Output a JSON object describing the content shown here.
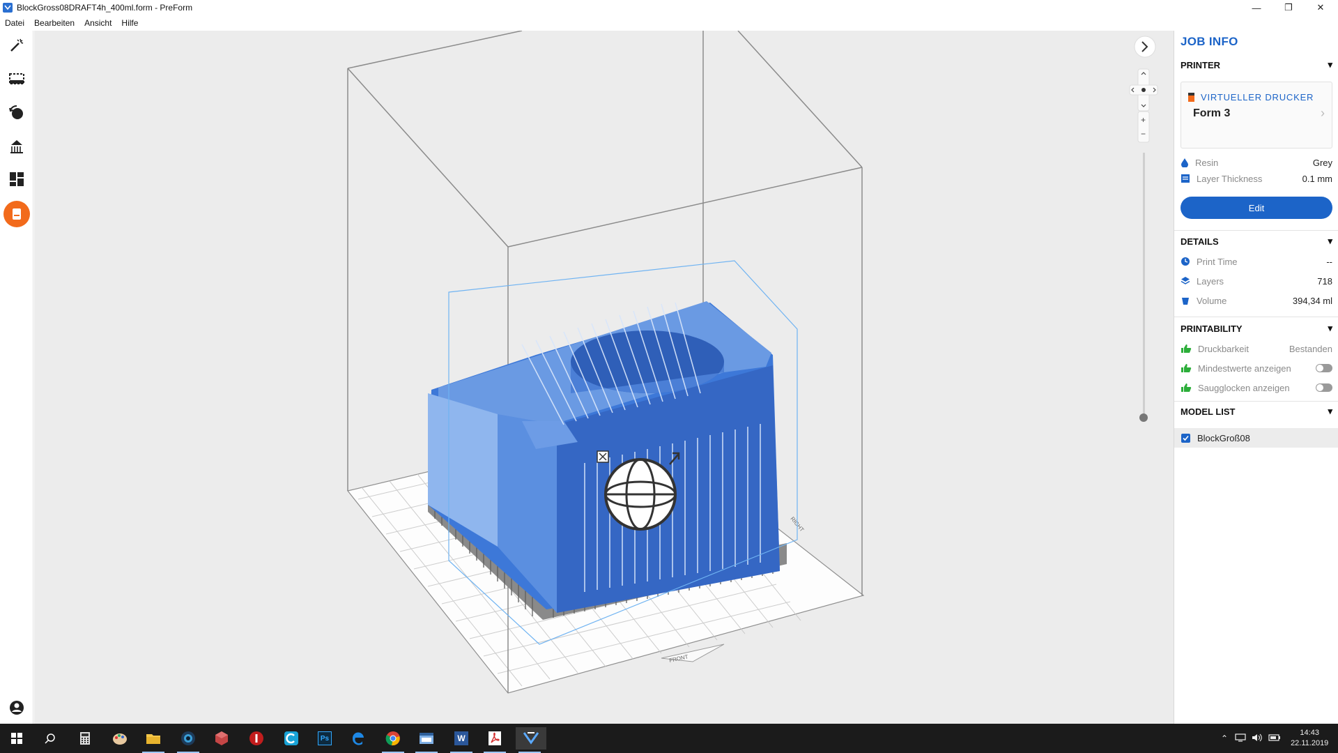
{
  "window": {
    "title": "BlockGross08DRAFT4h_400ml.form - PreForm",
    "minimize_glyph": "—",
    "maximize_glyph": "❐",
    "close_glyph": "✕"
  },
  "menu": [
    "Datei",
    "Bearbeiten",
    "Ansicht",
    "Hilfe"
  ],
  "toolbar": {
    "icons": [
      "magic-wand-icon",
      "select-region-icon",
      "orientation-icon",
      "supports-icon",
      "layout-icon",
      "print-icon",
      "account-icon"
    ],
    "active": "print-icon",
    "accent": "#f26a1b"
  },
  "viewport": {
    "background": "#ececec",
    "model_color": "#3d78d8",
    "support_color": "#8a8a8a",
    "platform_labels": [
      "FRONT",
      "RIGHT"
    ],
    "zoom_in": "+",
    "zoom_out": "−",
    "collapse_glyph": "›"
  },
  "panel": {
    "title": "JOB INFO",
    "accent": "#1c64c8",
    "printer": {
      "heading": "PRINTER",
      "type": "VIRTUELLER DRUCKER",
      "model": "Form 3",
      "resin_label": "Resin",
      "resin_value": "Grey",
      "layer_label": "Layer Thickness",
      "layer_value": "0.1 mm",
      "edit_label": "Edit"
    },
    "details": {
      "heading": "DETAILS",
      "print_time_label": "Print Time",
      "print_time_value": "--",
      "layers_label": "Layers",
      "layers_value": "718",
      "volume_label": "Volume",
      "volume_value": "394,34 ml"
    },
    "printability": {
      "heading": "PRINTABILITY",
      "druckbarkeit_label": "Druckbarkeit",
      "druckbarkeit_value": "Bestanden",
      "mindest_label": "Mindestwerte anzeigen",
      "saugglocken_label": "Saugglocken anzeigen",
      "status_color": "#2cae3a"
    },
    "model_list": {
      "heading": "MODEL LIST",
      "items": [
        "BlockGroß08"
      ]
    }
  },
  "taskbar": {
    "apps": [
      "windows-start-icon",
      "search-icon",
      "calculator-icon",
      "paint-icon",
      "file-explorer-icon",
      "camera-app-icon",
      "3d-app-icon",
      "red-app-icon",
      "c-app-icon",
      "photoshop-icon",
      "edge-icon",
      "chrome-icon",
      "window-app-icon",
      "word-icon",
      "acrobat-icon",
      "preform-icon"
    ],
    "photoshop_label": "Ps",
    "word_label": "W",
    "clock_time": "14:43",
    "clock_date": "22.11.2019"
  }
}
